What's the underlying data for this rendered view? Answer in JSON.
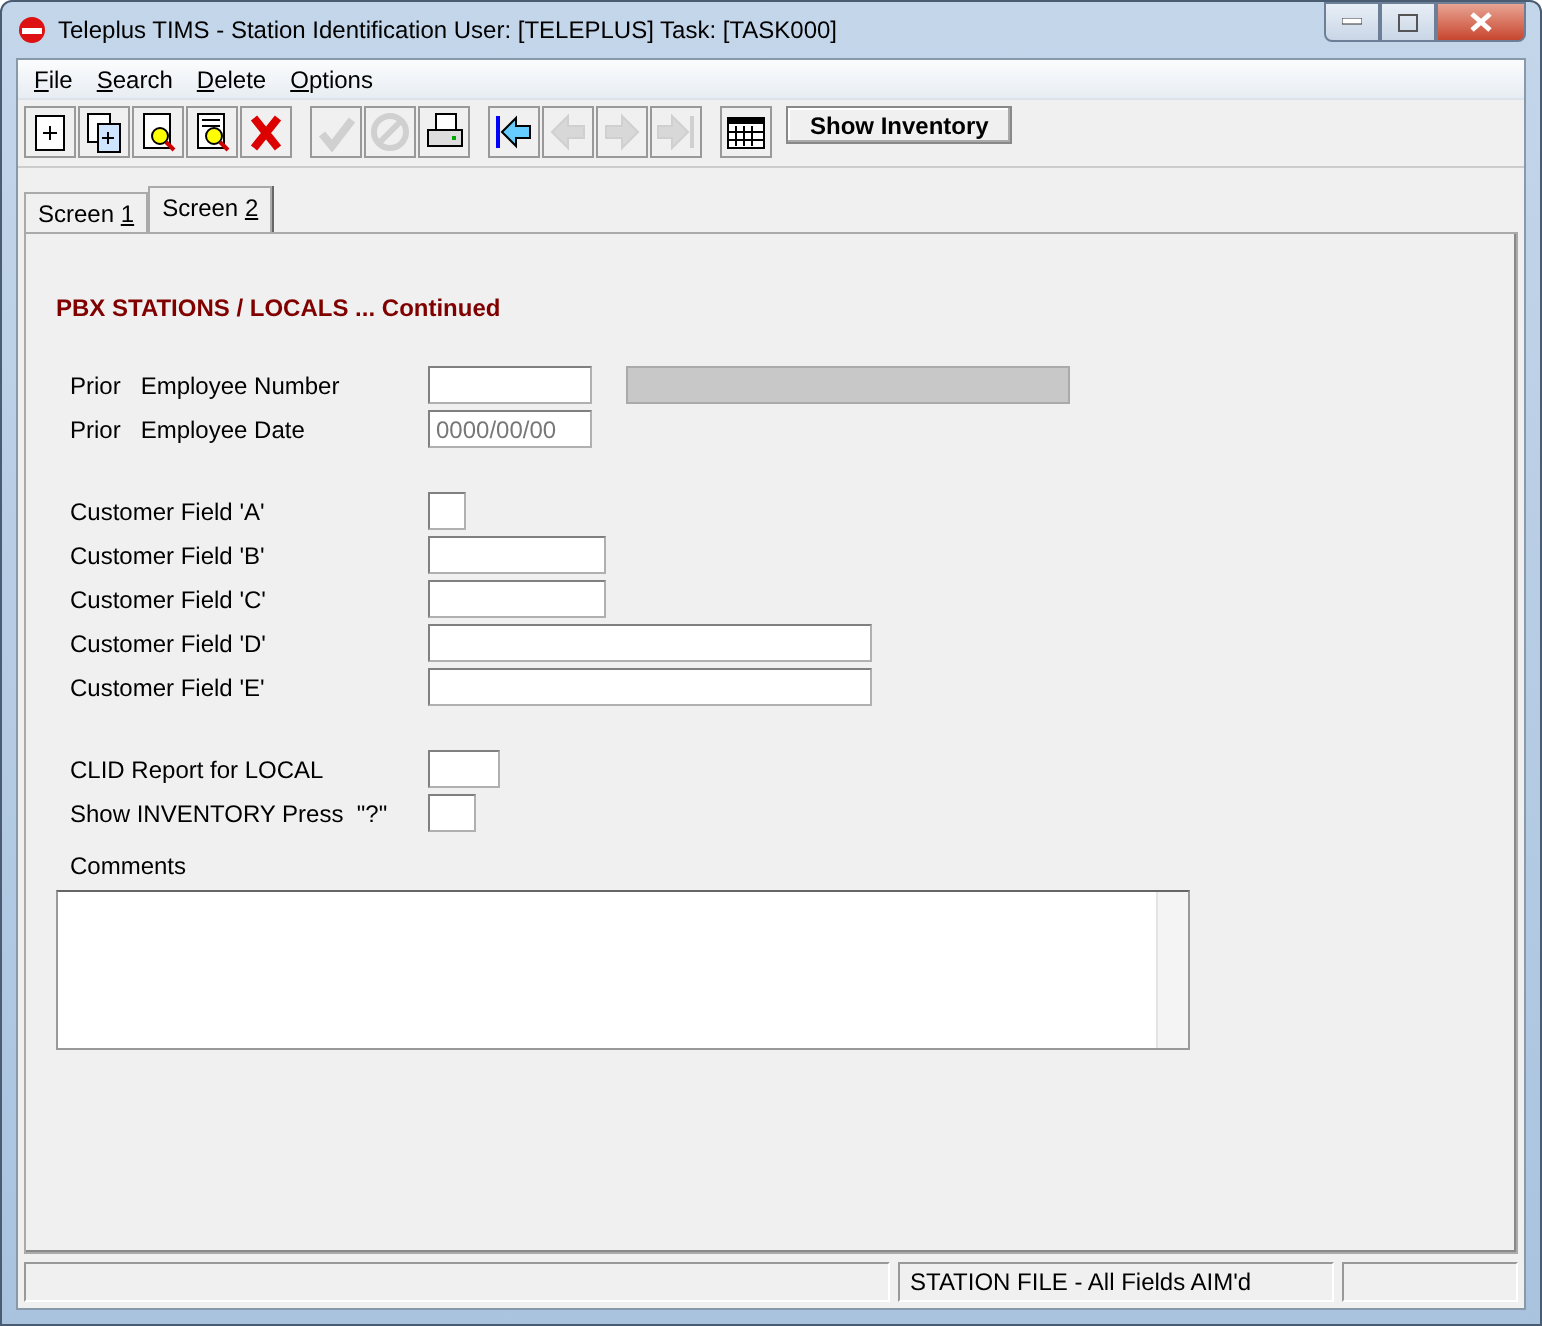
{
  "window": {
    "title": "Teleplus TIMS - Station Identification  User: [TELEPLUS]  Task: [TASK000]"
  },
  "menu": [
    {
      "mnemonic": "F",
      "rest": "ile"
    },
    {
      "mnemonic": "S",
      "rest": "earch"
    },
    {
      "mnemonic": "D",
      "rest": "elete"
    },
    {
      "mnemonic": "O",
      "rest": "ptions"
    }
  ],
  "toolbar": [
    {
      "kind": "new",
      "disabled": false
    },
    {
      "kind": "copy",
      "disabled": false
    },
    {
      "kind": "find",
      "disabled": false
    },
    {
      "kind": "browse",
      "disabled": false
    },
    {
      "kind": "delete",
      "disabled": false
    },
    {
      "kind": "accept",
      "disabled": true
    },
    {
      "kind": "cancel",
      "disabled": true
    },
    {
      "kind": "print",
      "disabled": false
    },
    {
      "kind": "first",
      "disabled": false
    },
    {
      "kind": "prev",
      "disabled": true
    },
    {
      "kind": "next",
      "disabled": true
    },
    {
      "kind": "last",
      "disabled": true
    },
    {
      "kind": "calendar",
      "disabled": false
    }
  ],
  "show_inventory_button": "Show Inventory",
  "tabs": [
    {
      "text": "Screen",
      "mnemonic": "1",
      "selected": false
    },
    {
      "text": "Screen",
      "mnemonic": "2",
      "selected": true
    }
  ],
  "heading": "PBX STATIONS / LOCALS ... Continued",
  "groups": [
    [
      {
        "label": "Prior   Employee Number",
        "kind": "medium",
        "display_field": true
      },
      {
        "label": "Prior   Employee Date",
        "kind": "medium",
        "value": "0000/00/00"
      }
    ],
    [
      {
        "label": "Customer Field 'A'",
        "kind": "tiny"
      },
      {
        "label": "Customer Field 'B'",
        "kind": "wide"
      },
      {
        "label": "Customer Field 'C'",
        "kind": "wide"
      },
      {
        "label": "Customer Field 'D'",
        "kind": "long"
      },
      {
        "label": "Customer Field 'E'",
        "kind": "long"
      }
    ],
    [
      {
        "label": "CLID Report for LOCAL",
        "kind": "small"
      },
      {
        "label": "Show INVENTORY Press  \"?\"",
        "kind": "tiny2"
      }
    ]
  ],
  "comments_label": "Comments",
  "status_bar": {
    "message": "STATION FILE - All Fields AIM'd"
  }
}
